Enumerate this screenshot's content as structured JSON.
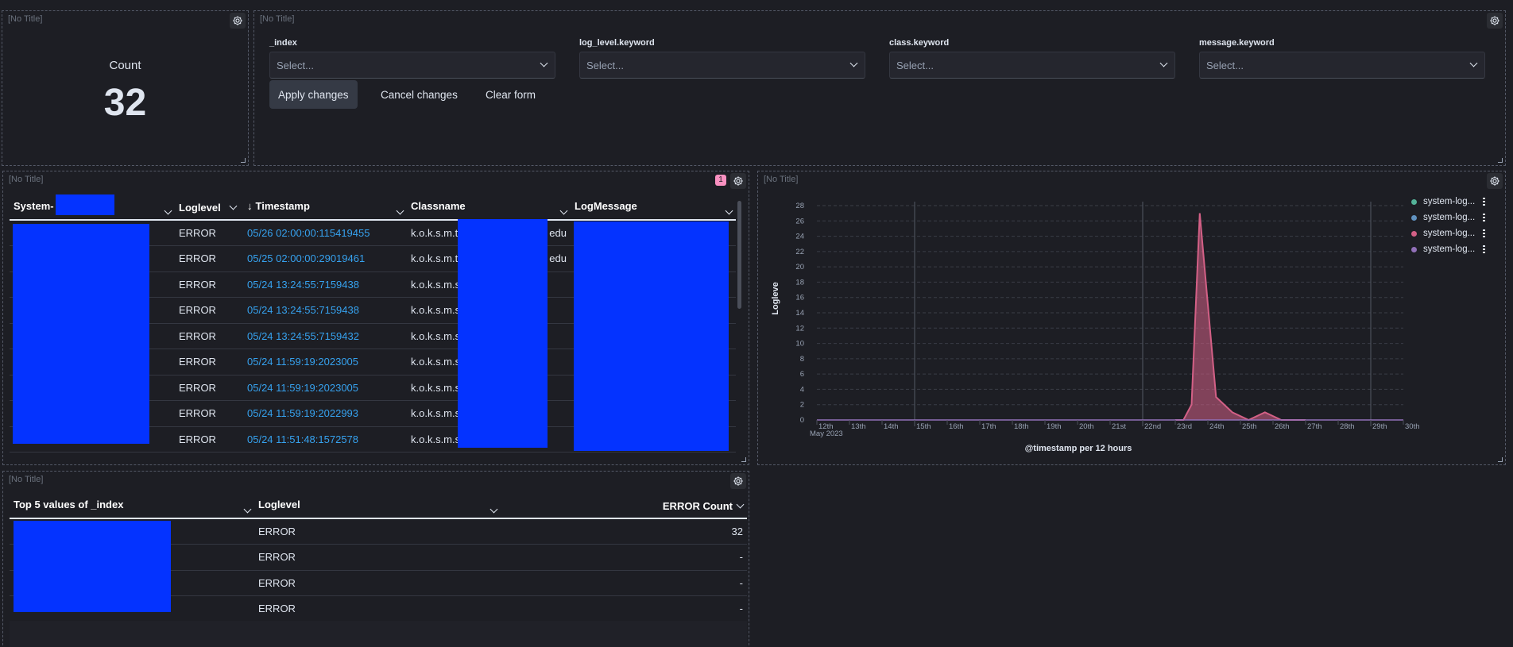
{
  "panels": {
    "no_title": "[No Title]"
  },
  "metric": {
    "label": "Count",
    "value": "32"
  },
  "controls": {
    "fields": [
      {
        "label": "_index",
        "placeholder": "Select..."
      },
      {
        "label": "log_level.keyword",
        "placeholder": "Select..."
      },
      {
        "label": "class.keyword",
        "placeholder": "Select..."
      },
      {
        "label": "message.keyword",
        "placeholder": "Select..."
      }
    ],
    "apply_label": "Apply changes",
    "cancel_label": "Cancel changes",
    "clear_label": "Clear form"
  },
  "log_table": {
    "badge": "1",
    "columns": [
      "System-",
      "Loglevel",
      "Timestamp",
      "Classname",
      "LogMessage"
    ],
    "rows": [
      {
        "level": "ERROR",
        "ts": "05/26 02:00:00:115419455",
        "cls": "k.o.k.s.m.t",
        "cls_tail": "edu",
        "msg_tail": ""
      },
      {
        "level": "ERROR",
        "ts": "05/25 02:00:00:29019461",
        "cls": "k.o.k.s.m.t",
        "cls_tail": "edu",
        "msg_tail": ""
      },
      {
        "level": "ERROR",
        "ts": "05/24 13:24:55:7159438",
        "cls": "k.o.k.s.m.s",
        "cls_tail": "",
        "msg_tail": ""
      },
      {
        "level": "ERROR",
        "ts": "05/24 13:24:55:7159438",
        "cls": "k.o.k.s.m.s",
        "cls_tail": "",
        "msg_tail": ""
      },
      {
        "level": "ERROR",
        "ts": "05/24 13:24:55:7159432",
        "cls": "k.o.k.s.m.s",
        "cls_tail": "",
        "msg_tail": ""
      },
      {
        "level": "ERROR",
        "ts": "05/24 11:59:19:2023005",
        "cls": "k.o.k.s.m.s",
        "cls_tail": "",
        "msg_tail": ""
      },
      {
        "level": "ERROR",
        "ts": "05/24 11:59:19:2023005",
        "cls": "k.o.k.s.m.s",
        "cls_tail": "",
        "msg_tail": ""
      },
      {
        "level": "ERROR",
        "ts": "05/24 11:59:19:2022993",
        "cls": "k.o.k.s.m.s",
        "cls_tail": "",
        "msg_tail": ""
      },
      {
        "level": "ERROR",
        "ts": "05/24 11:51:48:1572578",
        "cls": "k.o.k.s.m.s",
        "cls_tail": "",
        "msg_tail": ""
      }
    ]
  },
  "chart_data": {
    "type": "area",
    "title": "",
    "xlabel": "@timestamp per 12 hours",
    "ylabel": "Logleve",
    "x_month_label": "May 2023",
    "x_ticks": [
      "12th",
      "13th",
      "14th",
      "15th",
      "16th",
      "17th",
      "18th",
      "19th",
      "20th",
      "21st",
      "22nd",
      "23rd",
      "24th",
      "25th",
      "26th",
      "27th",
      "28th",
      "29th",
      "30th"
    ],
    "y_ticks": [
      0,
      2,
      4,
      6,
      8,
      10,
      12,
      14,
      16,
      18,
      20,
      22,
      24,
      26,
      28
    ],
    "ylim": [
      0,
      28
    ],
    "grid": true,
    "legend_position": "top-right",
    "series": [
      {
        "name": "system-log...",
        "color": "#54b399",
        "points": []
      },
      {
        "name": "system-log...",
        "color": "#6092c0",
        "points": []
      },
      {
        "name": "system-log...",
        "color": "#d36086",
        "points": [
          [
            23.0,
            0
          ],
          [
            23.25,
            0
          ],
          [
            23.5,
            2
          ],
          [
            23.75,
            27
          ],
          [
            24.25,
            3
          ],
          [
            24.75,
            1
          ],
          [
            25.25,
            0
          ],
          [
            25.75,
            1
          ],
          [
            26.25,
            0
          ],
          [
            27,
            0
          ]
        ]
      },
      {
        "name": "system-log...",
        "color": "#9170b8",
        "points": []
      }
    ],
    "x_start_day": 12,
    "x_end_day": 30
  },
  "top_table": {
    "columns": [
      "Top 5 values of _index",
      "Loglevel",
      "ERROR Count"
    ],
    "rows": [
      {
        "level": "ERROR",
        "count": "32"
      },
      {
        "level": "ERROR",
        "count": "-"
      },
      {
        "level": "ERROR",
        "count": "-"
      },
      {
        "level": "ERROR",
        "count": "-"
      }
    ]
  }
}
